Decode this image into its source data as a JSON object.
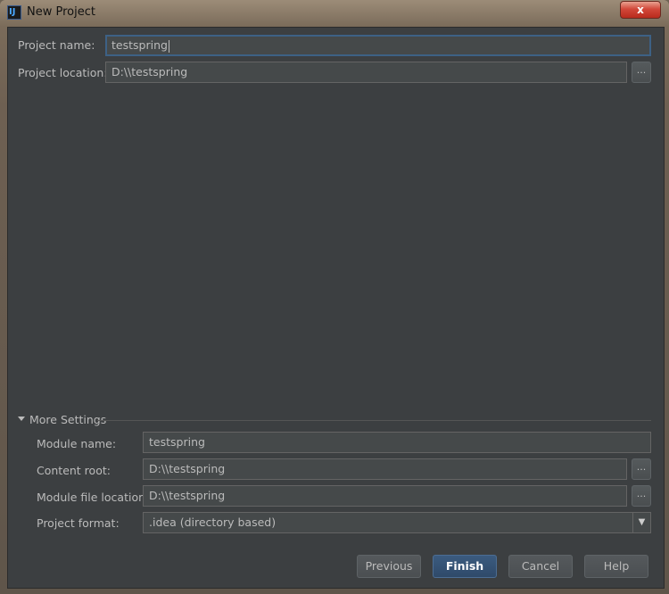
{
  "window": {
    "title": "New Project",
    "icon": "intellij-idea-icon",
    "icon_text": "IJ",
    "close_symbol": "x"
  },
  "project": {
    "name_label": "Project name:",
    "name_value": "testspring",
    "location_label": "Project location:",
    "location_value": "D:\\\\testspring",
    "browse_symbol": "..."
  },
  "more_settings": {
    "header": "More Settings",
    "module_name_label": "Module name:",
    "module_name_value": "testspring",
    "content_root_label": "Content root:",
    "content_root_value": "D:\\\\testspring",
    "module_file_label": "Module file location:",
    "module_file_value": "D:\\\\testspring",
    "project_format_label": "Project format:",
    "project_format_value": ".idea (directory based)",
    "browse_symbol": "..."
  },
  "buttons": {
    "previous": "Previous",
    "finish": "Finish",
    "cancel": "Cancel",
    "help": "Help"
  },
  "colors": {
    "background": "#3c3f41",
    "field": "#45494a",
    "text": "#bbbbbb",
    "focus": "#3d6185",
    "primary": "#365880"
  }
}
